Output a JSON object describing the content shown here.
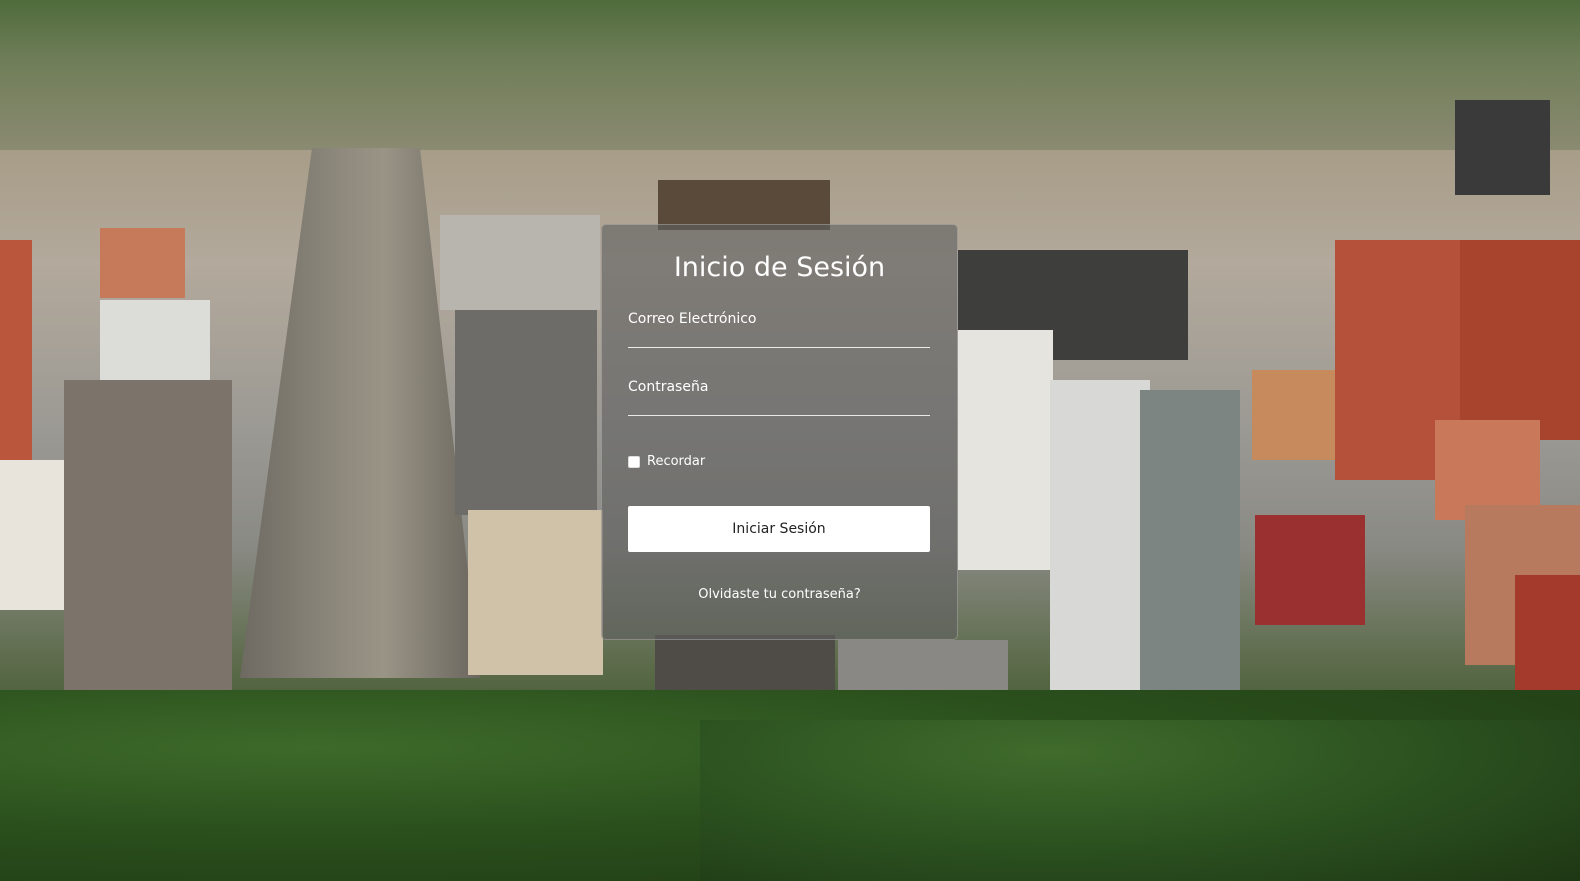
{
  "background": {
    "description_icon": "city-skyline-photo"
  },
  "login": {
    "title": "Inicio de Sesión",
    "email_placeholder": "Correo Electrónico",
    "email_value": "",
    "password_placeholder": "Contraseña",
    "password_value": "",
    "remember_label": "Recordar",
    "remember_checked": false,
    "submit_label": "Iniciar Sesión",
    "forgot_label": "Olvidaste tu contraseña?"
  }
}
